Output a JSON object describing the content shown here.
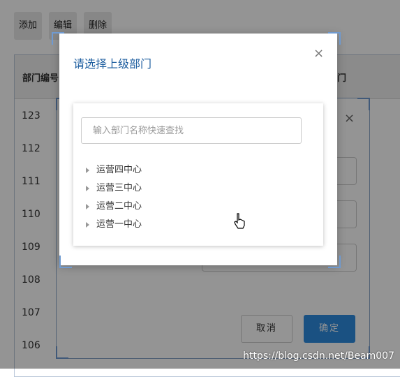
{
  "toolbar": {
    "add_label": "添加",
    "edit_label": "编辑",
    "delete_label": "删除"
  },
  "table": {
    "headers": [
      "部门编号",
      "门"
    ],
    "ids": [
      "123",
      "112",
      "111",
      "110",
      "109",
      "108",
      "107",
      "106"
    ]
  },
  "edit_dialog": {
    "close_glyph": "×",
    "cancel_label": "取消",
    "confirm_label": "确定"
  },
  "select_dialog": {
    "title": "请选择上级部门",
    "close_glyph": "×",
    "search_placeholder": "输入部门名称快速查找",
    "tree_items": [
      "运营四中心",
      "运营三中心",
      "运营二中心",
      "运营一中心"
    ]
  },
  "watermark": "https://blog.csdn.net/Beam007",
  "colors": {
    "primary": "#2d8ce0",
    "title": "#1f5fa0",
    "mask": "rgba(0,0,0,0.42)"
  }
}
